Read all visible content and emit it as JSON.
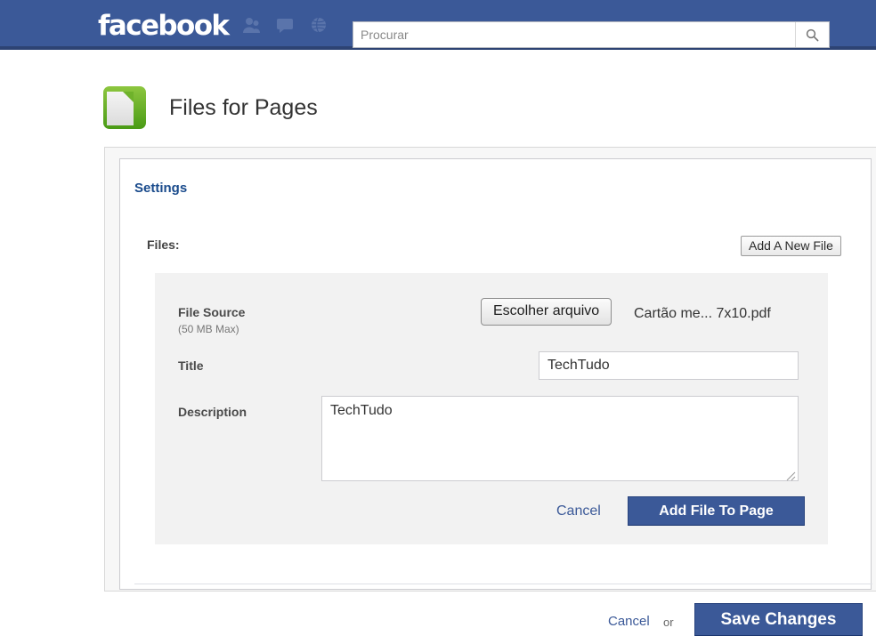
{
  "header": {
    "logo_text": "facebook",
    "brand_color": "#3b5998",
    "nav_icons": [
      {
        "name": "friends-icon",
        "title": "Friend Requests"
      },
      {
        "name": "messages-icon",
        "title": "Messages"
      },
      {
        "name": "globe-icon",
        "title": "Notifications"
      }
    ],
    "search": {
      "placeholder": "Procurar",
      "value": "",
      "button_icon": "search-icon"
    }
  },
  "app": {
    "title": "Files for Pages",
    "icon": "green-document-icon"
  },
  "settings": {
    "heading": "Settings",
    "files_label": "Files:",
    "add_new_file_label": "Add A New File",
    "form": {
      "file_source_label": "File Source",
      "file_source_note": "(50 MB Max)",
      "choose_file_label": "Escolher arquivo",
      "chosen_file_name": "Cartão me... 7x10.pdf",
      "title_label": "Title",
      "title_value": "TechTudo",
      "title_placeholder": "",
      "description_label": "Description",
      "description_value": "TechTudo",
      "description_placeholder": "",
      "cancel_label": "Cancel",
      "submit_label": "Add File To Page"
    }
  },
  "footer": {
    "cancel_label": "Cancel",
    "or_label": "or",
    "save_label": "Save Changes"
  }
}
